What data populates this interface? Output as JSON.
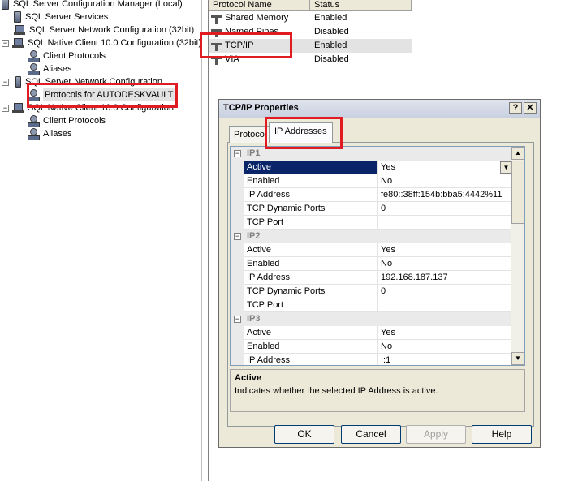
{
  "tree": {
    "items": [
      {
        "label": "SQL Server Configuration Manager (Local)"
      },
      {
        "label": "SQL Server Services"
      },
      {
        "label": "SQL Server Network Configuration (32bit)"
      },
      {
        "label": "SQL Native Client 10.0 Configuration (32bit)"
      },
      {
        "label": "Client Protocols"
      },
      {
        "label": "Aliases"
      },
      {
        "label": "SQL Server Network Configuration"
      },
      {
        "label": "Protocols for AUTODESKVAULT"
      },
      {
        "label": "SQL Native Client 10.0 Configuration"
      },
      {
        "label": "Client Protocols"
      },
      {
        "label": "Aliases"
      }
    ]
  },
  "list": {
    "columns": [
      "Protocol Name",
      "Status"
    ],
    "rows": [
      {
        "name": "Shared Memory",
        "status": "Enabled"
      },
      {
        "name": "Named Pipes",
        "status": "Disabled"
      },
      {
        "name": "TCP/IP",
        "status": "Enabled"
      },
      {
        "name": "VIA",
        "status": "Disabled"
      }
    ]
  },
  "dialog": {
    "title": "TCP/IP Properties",
    "help_label": "?",
    "close_label": "✕",
    "tabs": [
      "Protocol",
      "IP Addresses"
    ],
    "grid": {
      "sections": [
        {
          "label": "IP1",
          "props": [
            {
              "name": "Active",
              "value": "Yes"
            },
            {
              "name": "Enabled",
              "value": "No"
            },
            {
              "name": "IP Address",
              "value": "fe80::38ff:154b:bba5:4442%11"
            },
            {
              "name": "TCP Dynamic Ports",
              "value": "0"
            },
            {
              "name": "TCP Port",
              "value": ""
            }
          ]
        },
        {
          "label": "IP2",
          "props": [
            {
              "name": "Active",
              "value": "Yes"
            },
            {
              "name": "Enabled",
              "value": "No"
            },
            {
              "name": "IP Address",
              "value": "192.168.187.137"
            },
            {
              "name": "TCP Dynamic Ports",
              "value": "0"
            },
            {
              "name": "TCP Port",
              "value": ""
            }
          ]
        },
        {
          "label": "IP3",
          "props": [
            {
              "name": "Active",
              "value": "Yes"
            },
            {
              "name": "Enabled",
              "value": "No"
            },
            {
              "name": "IP Address",
              "value": "::1"
            }
          ]
        }
      ]
    },
    "description": {
      "title": "Active",
      "text": "Indicates whether the selected IP Address is active."
    },
    "buttons": {
      "ok": "OK",
      "cancel": "Cancel",
      "apply": "Apply",
      "help": "Help"
    }
  },
  "colors": {
    "highlight": "#e11b22",
    "selection": "#0a246a"
  }
}
